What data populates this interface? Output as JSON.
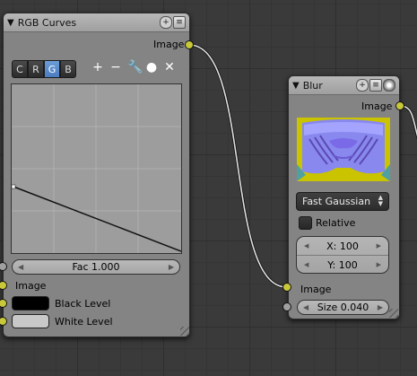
{
  "rgb_curves_node": {
    "title": "RGB Curves",
    "output_label": "Image",
    "channels": [
      "C",
      "R",
      "G",
      "B"
    ],
    "active_channel": "G",
    "tool_icons": [
      "plus-icon",
      "minus-icon",
      "wrench-icon",
      "dot-icon",
      "x-icon"
    ],
    "fac_field": "Fac 1.000",
    "inputs": {
      "image_label": "Image",
      "black_level_label": "Black Level",
      "white_level_label": "White Level"
    },
    "black_level_color": "#000000",
    "white_level_color": "#c8c8c8"
  },
  "blur_node": {
    "title": "Blur",
    "output_label": "Image",
    "filter_type": "Fast Gaussian",
    "relative_label": "Relative",
    "relative_checked": false,
    "size_x": "X: 100",
    "size_y": "Y: 100",
    "image_input_label": "Image",
    "size_field": "Size 0.040"
  },
  "colors": {
    "canvas_bg": "#3a3a3a",
    "node_body": "#848484",
    "socket_yellow": "#c8c83a",
    "socket_grey": "#a0a0a0",
    "active_channel": "#5a8ccf",
    "preview_bg": "#c9c300"
  }
}
